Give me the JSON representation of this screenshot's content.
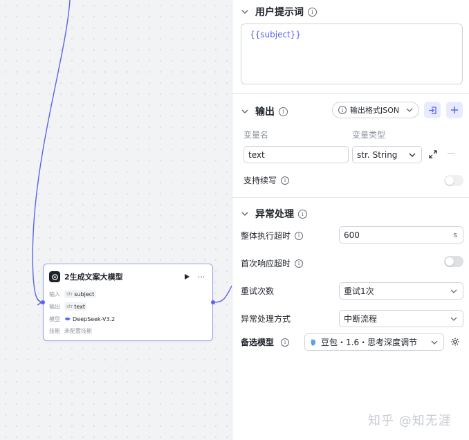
{
  "canvas": {
    "node": {
      "title": "2生成文案大模型",
      "input_label": "输入",
      "input_type": "str",
      "input_value": "subject",
      "output_label": "输出",
      "output_type": "str",
      "output_value": "text",
      "model_label": "模型",
      "model_value": "DeepSeek-V3.2",
      "skill_label": "技能",
      "skill_value": "未配置技能",
      "more": "···"
    }
  },
  "panel": {
    "user_prompt": {
      "title": "用户提示词",
      "value": "{{subject}}"
    },
    "output": {
      "title": "输出",
      "format_label": "输出格式JSON",
      "col_name": "变量名",
      "col_type": "变量类型",
      "var_name": "text",
      "var_type_prefix": "str.",
      "var_type": "String",
      "remove": "—",
      "continue_label": "支持续写"
    },
    "exception": {
      "title": "异常处理",
      "timeout_label": "整体执行超时",
      "timeout_value": "600",
      "timeout_unit": "s",
      "first_response_label": "首次响应超时",
      "retry_label": "重试次数",
      "retry_value": "重试1次",
      "handle_label": "异常处理方式",
      "handle_value": "中断流程",
      "backup_label": "备选模型",
      "backup_value": "豆包・1.6・思考深度调节"
    }
  },
  "watermark": "知乎 @知无涯",
  "colors": {
    "accent": "#5b63e8",
    "border": "#d0d3d6",
    "canvas": "#f2f3f5"
  }
}
